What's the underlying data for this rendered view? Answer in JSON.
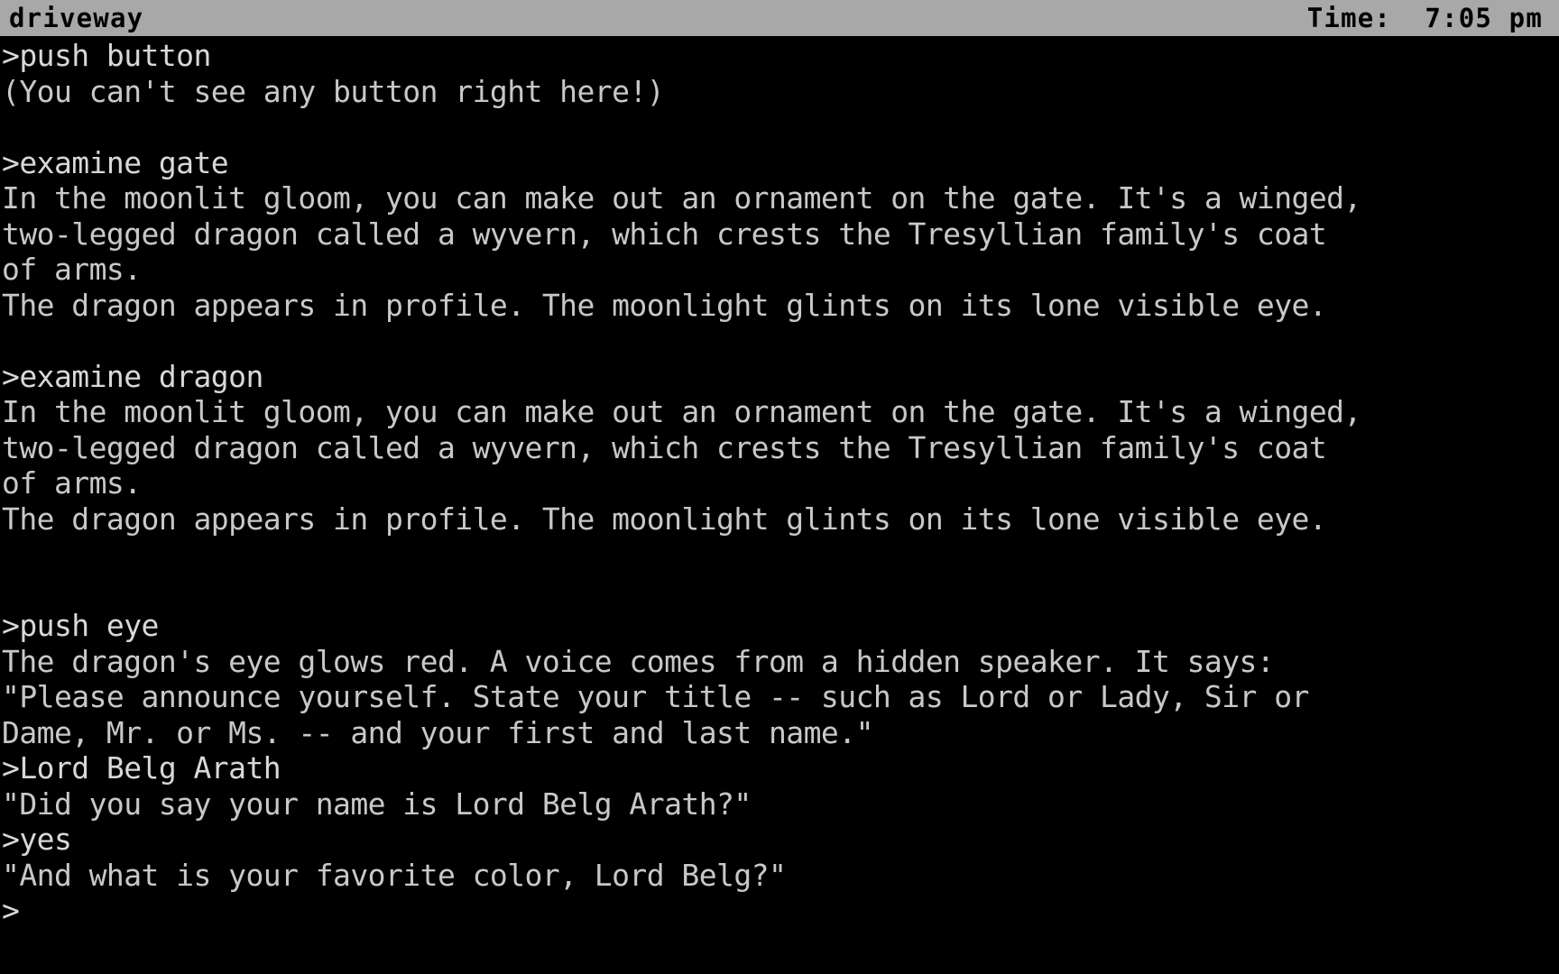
{
  "window": {
    "kind": "interactive-fiction-interpreter",
    "background_color": "#000000",
    "text_color": "#c8c8c8"
  },
  "statusbar": {
    "location": "driveway",
    "time_label": "Time:",
    "time_value": "7:05 pm",
    "time_text": "Time:  7:05 pm",
    "background_color": "#a8a8a8",
    "text_color": "#000000"
  },
  "transcript": {
    "prompt_char": ">",
    "cursor_line": ">",
    "lines": [
      {
        "type": "command",
        "text": ">push button"
      },
      {
        "type": "response",
        "text": "(You can't see any button right here!)"
      },
      {
        "type": "blank",
        "text": ""
      },
      {
        "type": "command",
        "text": ">examine gate"
      },
      {
        "type": "response",
        "text": "In the moonlit gloom, you can make out an ornament on the gate. It's a winged,"
      },
      {
        "type": "response",
        "text": "two-legged dragon called a wyvern, which crests the Tresyllian family's coat"
      },
      {
        "type": "response",
        "text": "of arms."
      },
      {
        "type": "response",
        "text": "The dragon appears in profile. The moonlight glints on its lone visible eye."
      },
      {
        "type": "blank",
        "text": ""
      },
      {
        "type": "command",
        "text": ">examine dragon"
      },
      {
        "type": "response",
        "text": "In the moonlit gloom, you can make out an ornament on the gate. It's a winged,"
      },
      {
        "type": "response",
        "text": "two-legged dragon called a wyvern, which crests the Tresyllian family's coat"
      },
      {
        "type": "response",
        "text": "of arms."
      },
      {
        "type": "response",
        "text": "The dragon appears in profile. The moonlight glints on its lone visible eye."
      },
      {
        "type": "blank",
        "text": ""
      },
      {
        "type": "blank",
        "text": ""
      },
      {
        "type": "command",
        "text": ">push eye"
      },
      {
        "type": "response",
        "text": "The dragon's eye glows red. A voice comes from a hidden speaker. It says:"
      },
      {
        "type": "response",
        "text": "\"Please announce yourself. State your title -- such as Lord or Lady, Sir or"
      },
      {
        "type": "response",
        "text": "Dame, Mr. or Ms. -- and your first and last name.\""
      },
      {
        "type": "command",
        "text": ">Lord Belg Arath"
      },
      {
        "type": "response",
        "text": "\"Did you say your name is Lord Belg Arath?\""
      },
      {
        "type": "command",
        "text": ">yes"
      },
      {
        "type": "response",
        "text": "\"And what is your favorite color, Lord Belg?\""
      }
    ]
  }
}
